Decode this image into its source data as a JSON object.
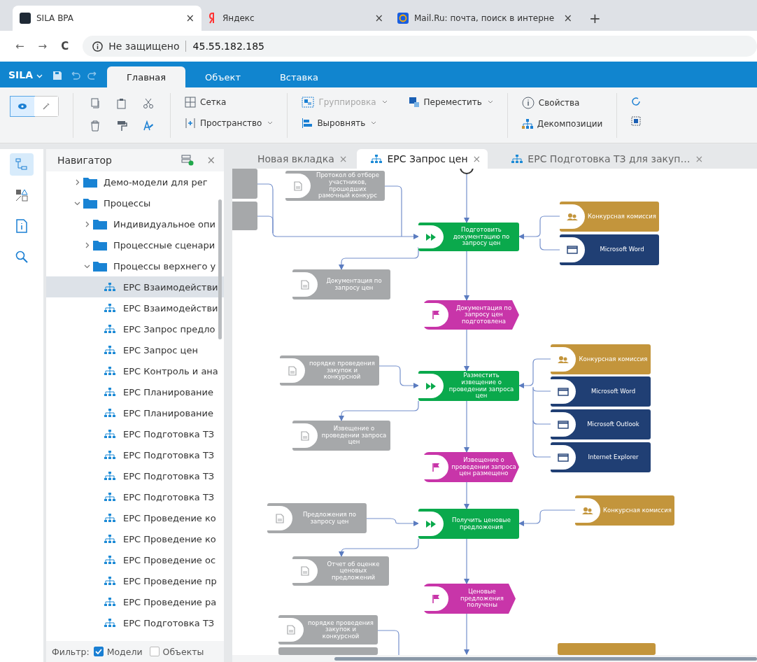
{
  "browser": {
    "tabs": [
      {
        "title": "SILA BPA",
        "selected": true
      },
      {
        "title": "Яндекс",
        "selected": false
      },
      {
        "title": "Mail.Ru: почта, поиск в интерне",
        "selected": false
      }
    ],
    "new_tab": "+",
    "close": "×",
    "back": "←",
    "forward": "→",
    "reload": "C",
    "security": "Не защищено",
    "url": "45.55.182.185"
  },
  "app": {
    "logo": "SILA",
    "tabs": [
      {
        "label": "Главная",
        "selected": true
      },
      {
        "label": "Объект",
        "selected": false
      },
      {
        "label": "Вставка",
        "selected": false
      }
    ]
  },
  "ribbon": {
    "modes": [
      {
        "kind": "view",
        "selected": true
      },
      {
        "kind": "edit",
        "selected": false
      }
    ],
    "commands": [
      {
        "label": "Сетка",
        "kind": "grid",
        "dropdown": false,
        "disabled": false
      },
      {
        "label": "Пространство",
        "kind": "space",
        "dropdown": true,
        "disabled": false
      },
      {
        "label": "Группировка",
        "kind": "group",
        "dropdown": true,
        "disabled": true
      },
      {
        "label": "Выровнять",
        "kind": "align",
        "dropdown": true,
        "disabled": false
      },
      {
        "label": "Переместить",
        "kind": "move",
        "dropdown": true,
        "disabled": false
      },
      {
        "label": "Свойства",
        "kind": "info",
        "dropdown": false,
        "disabled": false
      },
      {
        "label": "Декомпозиции",
        "kind": "decomp",
        "dropdown": false,
        "disabled": false
      }
    ]
  },
  "side_icons": [
    {
      "kind": "tree",
      "selected": true
    },
    {
      "kind": "shapes",
      "selected": false
    },
    {
      "kind": "document",
      "selected": false
    },
    {
      "kind": "search",
      "selected": false
    }
  ],
  "navigator": {
    "title": "Навигатор",
    "close": "×",
    "tree": [
      {
        "label": "Демо-модели для рег",
        "kind": "folder",
        "expanded": false,
        "selected": false
      },
      {
        "label": "Процессы",
        "kind": "folder",
        "expanded": true,
        "selected": false,
        "children": [
          {
            "label": "Индивидуальное опи",
            "kind": "folder",
            "expanded": false,
            "selected": false
          },
          {
            "label": "Процессные сценари",
            "kind": "folder",
            "expanded": false,
            "selected": false
          },
          {
            "label": "Процессы верхнего у",
            "kind": "folder",
            "expanded": true,
            "selected": false,
            "children": [
              {
                "label": "EPC Взаимодействи",
                "kind": "model",
                "selected": true
              },
              {
                "label": "EPC Взаимодействи",
                "kind": "model",
                "selected": false
              },
              {
                "label": "EPC Запрос предло",
                "kind": "model",
                "selected": false
              },
              {
                "label": "EPC Запрос цен",
                "kind": "model",
                "selected": false
              },
              {
                "label": "EPC Контроль и ана",
                "kind": "model",
                "selected": false
              },
              {
                "label": "EPC Планирование",
                "kind": "model",
                "selected": false
              },
              {
                "label": "EPC Планирование",
                "kind": "model",
                "selected": false
              },
              {
                "label": "EPC Подготовка ТЗ",
                "kind": "model",
                "selected": false
              },
              {
                "label": "EPC Подготовка ТЗ",
                "kind": "model",
                "selected": false
              },
              {
                "label": "EPC Подготовка ТЗ",
                "kind": "model",
                "selected": false
              },
              {
                "label": "EPC Подготовка ТЗ",
                "kind": "model",
                "selected": false
              },
              {
                "label": "EPC Проведение ко",
                "kind": "model",
                "selected": false
              },
              {
                "label": "EPC Проведение ко",
                "kind": "model",
                "selected": false
              },
              {
                "label": "EPC Проведение ос",
                "kind": "model",
                "selected": false
              },
              {
                "label": "EPC Проведение пр",
                "kind": "model",
                "selected": false
              },
              {
                "label": "EPC Проведение ра",
                "kind": "model",
                "selected": false
              },
              {
                "label": "EPC Подготовка ТЗ",
                "kind": "model",
                "selected": false
              }
            ]
          }
        ]
      }
    ],
    "filter": {
      "label": "Фильтр:",
      "options": [
        {
          "label": "Модели",
          "checked": true
        },
        {
          "label": "Объекты",
          "checked": false
        }
      ]
    }
  },
  "editor_tabs": [
    {
      "title": "Новая вкладка",
      "icon": false,
      "selected": false
    },
    {
      "title": "EPC Запрос цен",
      "icon": true,
      "selected": true
    },
    {
      "title": "EPC Подготовка ТЗ для закуп…",
      "icon": true,
      "selected": false
    }
  ],
  "tab_close": "×",
  "diagram": {
    "nodes": [
      {
        "kind": "document"
      },
      {
        "kind": "document"
      },
      {
        "kind": "document",
        "text": "Протокол об отборе участников, прошедших рамочный конкурс"
      },
      {
        "kind": "function",
        "text": "Подготовить документацию по запросу цен"
      },
      {
        "kind": "org",
        "text": "Конкурсная комиссия"
      },
      {
        "kind": "app",
        "text": "Microsoft Word"
      },
      {
        "kind": "document",
        "text": "Документация по запросу цен"
      },
      {
        "kind": "event",
        "text": "Документация по запросу цен подготовлена"
      },
      {
        "kind": "document",
        "text": "порядке проведения закупок и конкурсной"
      },
      {
        "kind": "function",
        "text": "Разместить извещение о проведении запроса цен"
      },
      {
        "kind": "org",
        "text": "Конкурсная комиссия"
      },
      {
        "kind": "app",
        "text": "Microsoft Word"
      },
      {
        "kind": "app",
        "text": "Microsoft Outlook"
      },
      {
        "kind": "app",
        "text": "Internet Explorer"
      },
      {
        "kind": "document",
        "text": "Извещение о проведении запроса цен"
      },
      {
        "kind": "event",
        "text": "Извещение о проведении запроса цен размещено"
      },
      {
        "kind": "document",
        "text": "Предложения по запросу цен"
      },
      {
        "kind": "function",
        "text": "Получить ценовые предложения"
      },
      {
        "kind": "org",
        "text": "Конкурсная комиссия"
      },
      {
        "kind": "document",
        "text": "Отчет об оценке ценовых предложений"
      },
      {
        "kind": "event",
        "text": "Ценовые предложения получены"
      },
      {
        "kind": "document",
        "text": "порядке проведения закупок и конкурсной"
      },
      {
        "kind": "document"
      },
      {
        "kind": "org"
      }
    ]
  }
}
